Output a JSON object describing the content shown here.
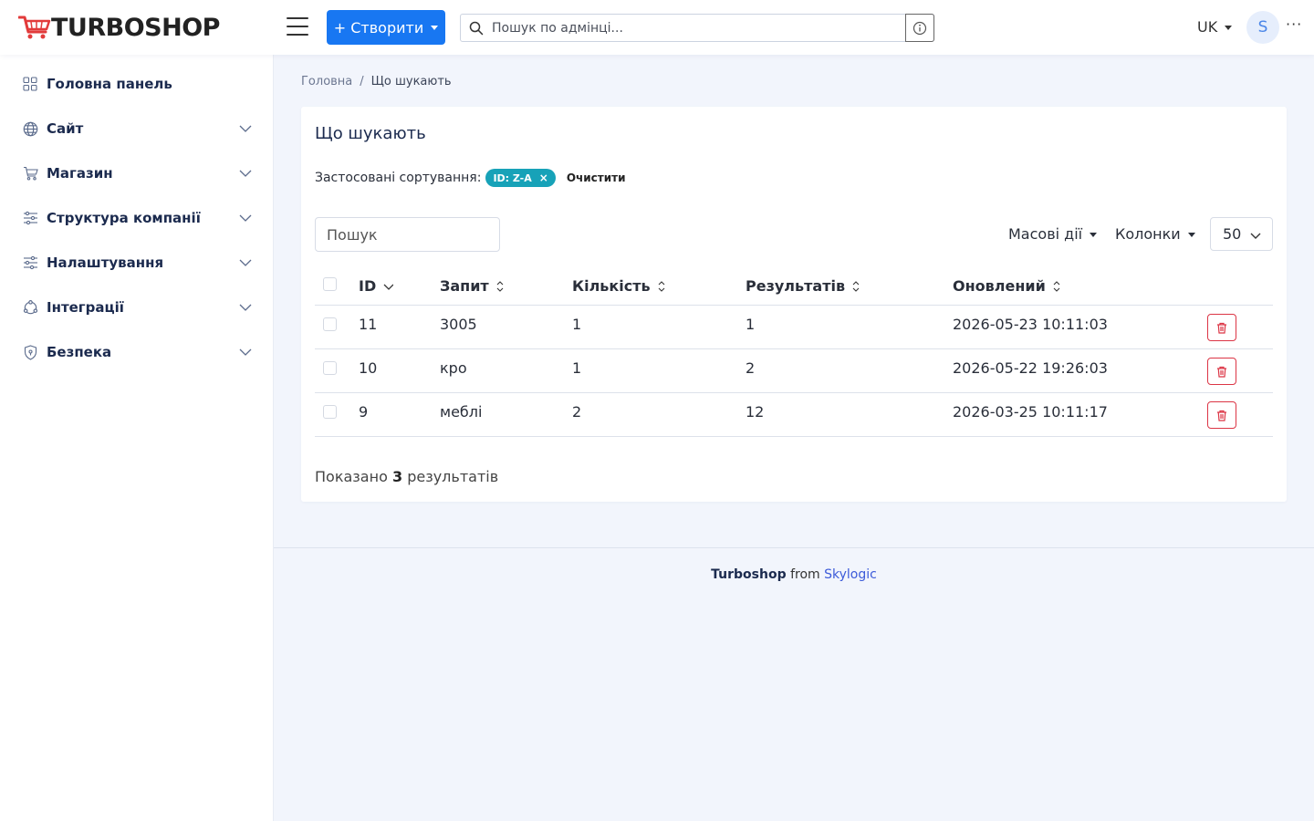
{
  "header": {
    "logo_text": "TURBOSHOP",
    "create_label": "+ Створити",
    "search_placeholder": "Пошук по адмінці...",
    "lang": "UK",
    "avatar_initial": "S",
    "more": "···"
  },
  "sidebar": {
    "items": [
      {
        "label": "Головна панель",
        "icon": "grid-icon"
      },
      {
        "label": "Сайт",
        "icon": "globe-icon"
      },
      {
        "label": "Магазин",
        "icon": "cart-icon"
      },
      {
        "label": "Структура компанії",
        "icon": "sliders-icon"
      },
      {
        "label": "Налаштування",
        "icon": "settings-sliders-icon"
      },
      {
        "label": "Інтеграції",
        "icon": "integrations-icon"
      },
      {
        "label": "Безпека",
        "icon": "shield-icon"
      }
    ]
  },
  "breadcrumb": {
    "home": "Головна",
    "separator": "/",
    "current": "Що шукають"
  },
  "card": {
    "title": "Що шукають",
    "sorts_label": "Застосовані сортування:",
    "sort_chip": "ID: Z-A",
    "sort_chip_close": "×",
    "clear_label": "Очистити",
    "search_placeholder": "Пошук",
    "bulk_actions": "Масові дії",
    "columns": "Колонки",
    "per_page": "50"
  },
  "table": {
    "headers": [
      "ID",
      "Запит",
      "Кількість",
      "Результатів",
      "Оновлений"
    ],
    "rows": [
      {
        "id": "11",
        "query": "3005",
        "count": "1",
        "results": "1",
        "updated": "2026-05-23 10:11:03"
      },
      {
        "id": "10",
        "query": "кро",
        "count": "1",
        "results": "2",
        "updated": "2026-05-22 19:26:03"
      },
      {
        "id": "9",
        "query": "меблі",
        "count": "2",
        "results": "12",
        "updated": "2026-03-25 10:11:17"
      }
    ]
  },
  "summary": {
    "prefix": "Показано",
    "count": "3",
    "suffix": "результатів"
  },
  "footer": {
    "brand": "Turboshop",
    "from": "from",
    "link": "Skylogic"
  },
  "colors": {
    "primary": "#1877f2",
    "chip": "#17a2b8",
    "danger": "#dc3545",
    "nav_text": "#1b2a4e",
    "background": "#f2f5fc"
  }
}
